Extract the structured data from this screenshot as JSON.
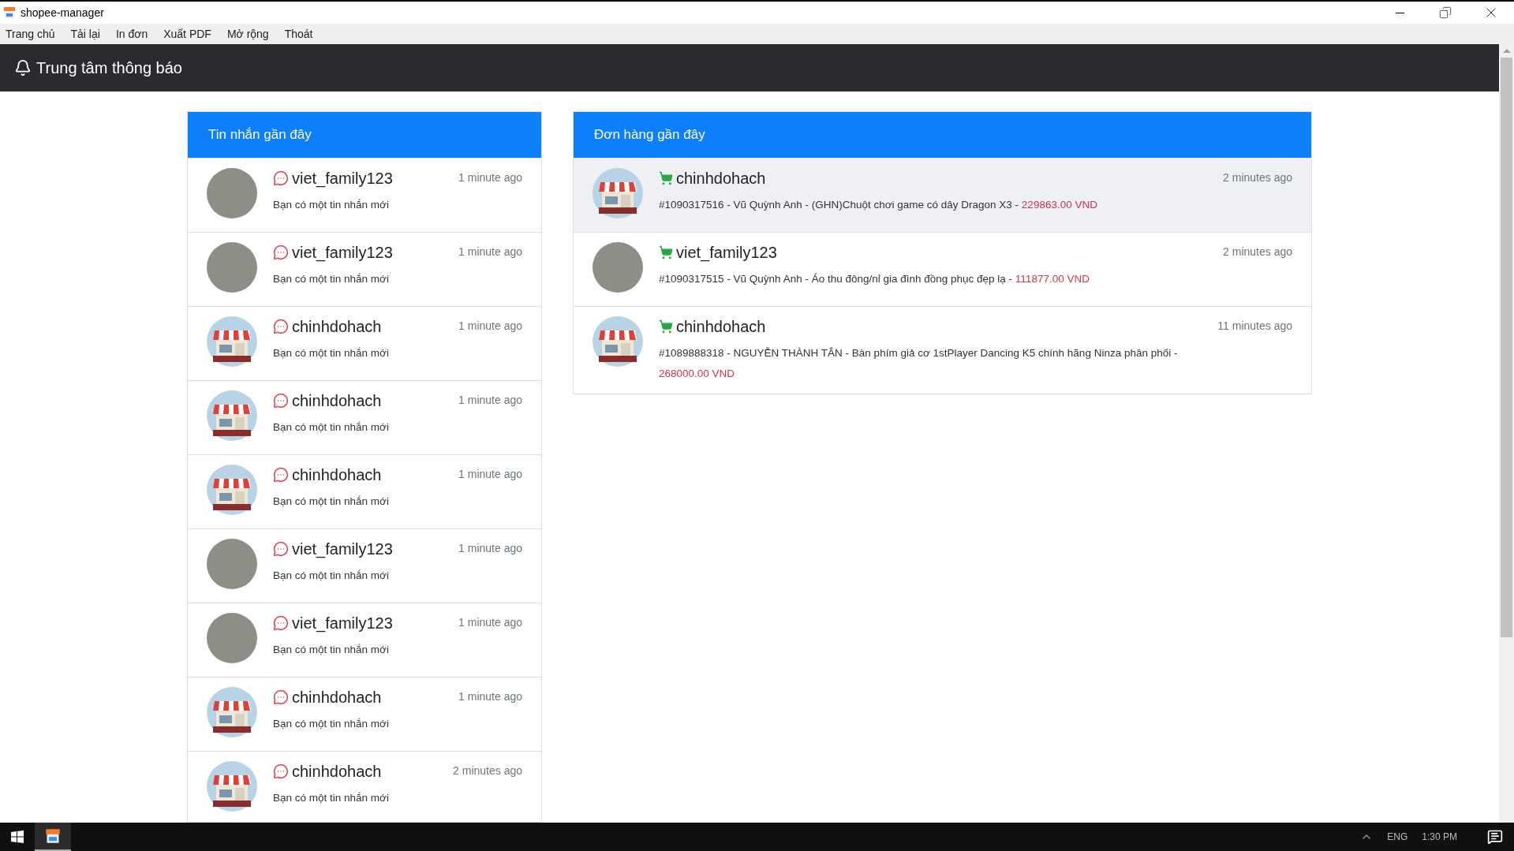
{
  "window": {
    "title": "shopee-manager"
  },
  "menu": [
    "Trang chủ",
    "Tải lại",
    "In đơn",
    "Xuất PDF",
    "Mở rộng",
    "Thoát"
  ],
  "header": {
    "title": "Trung tâm thông báo"
  },
  "messages": {
    "title": "Tin nhắn gần đây",
    "items": [
      {
        "kind": "photo",
        "user": "viet_family123",
        "time": "1 minute ago",
        "text": "Bạn có một tin nhắn mới"
      },
      {
        "kind": "photo",
        "user": "viet_family123",
        "time": "1 minute ago",
        "text": "Bạn có một tin nhắn mới"
      },
      {
        "kind": "store",
        "user": "chinhdohach",
        "time": "1 minute ago",
        "text": "Bạn có một tin nhắn mới"
      },
      {
        "kind": "store",
        "user": "chinhdohach",
        "time": "1 minute ago",
        "text": "Bạn có một tin nhắn mới"
      },
      {
        "kind": "store",
        "user": "chinhdohach",
        "time": "1 minute ago",
        "text": "Bạn có một tin nhắn mới"
      },
      {
        "kind": "photo",
        "user": "viet_family123",
        "time": "1 minute ago",
        "text": "Bạn có một tin nhắn mới"
      },
      {
        "kind": "photo",
        "user": "viet_family123",
        "time": "1 minute ago",
        "text": "Bạn có một tin nhắn mới"
      },
      {
        "kind": "store",
        "user": "chinhdohach",
        "time": "1 minute ago",
        "text": "Bạn có một tin nhắn mới"
      },
      {
        "kind": "store",
        "user": "chinhdohach",
        "time": "2 minutes ago",
        "text": "Bạn có một tin nhắn mới"
      }
    ]
  },
  "orders": {
    "title": "Đơn hàng gần đây",
    "items": [
      {
        "kind": "store",
        "user": "chinhdohach",
        "time": "2 minutes ago",
        "text": "#1090317516 - Vũ Quỳnh Anh - (GHN)Chuột chơi game có dây Dragon X3 -",
        "price": "229863.00 VND",
        "selected": true
      },
      {
        "kind": "photo",
        "user": "viet_family123",
        "time": "2 minutes ago",
        "text": "#1090317515 - Vũ Quỳnh Anh - Áo thu đông/nỉ gia đình đồng phục đẹp lạ -",
        "price": "111877.00 VND",
        "selected": false
      },
      {
        "kind": "store",
        "user": "chinhdohach",
        "time": "11 minutes ago",
        "text": "#1089888318 - NGUYỄN THÀNH TÂN - Bàn phím giả cơ 1stPlayer Dancing K5 chính hãng Ninza phân phối -",
        "price": "268000.00 VND",
        "selected": false
      }
    ]
  },
  "taskbar": {
    "language": "ENG",
    "clock": "1:30 PM"
  }
}
